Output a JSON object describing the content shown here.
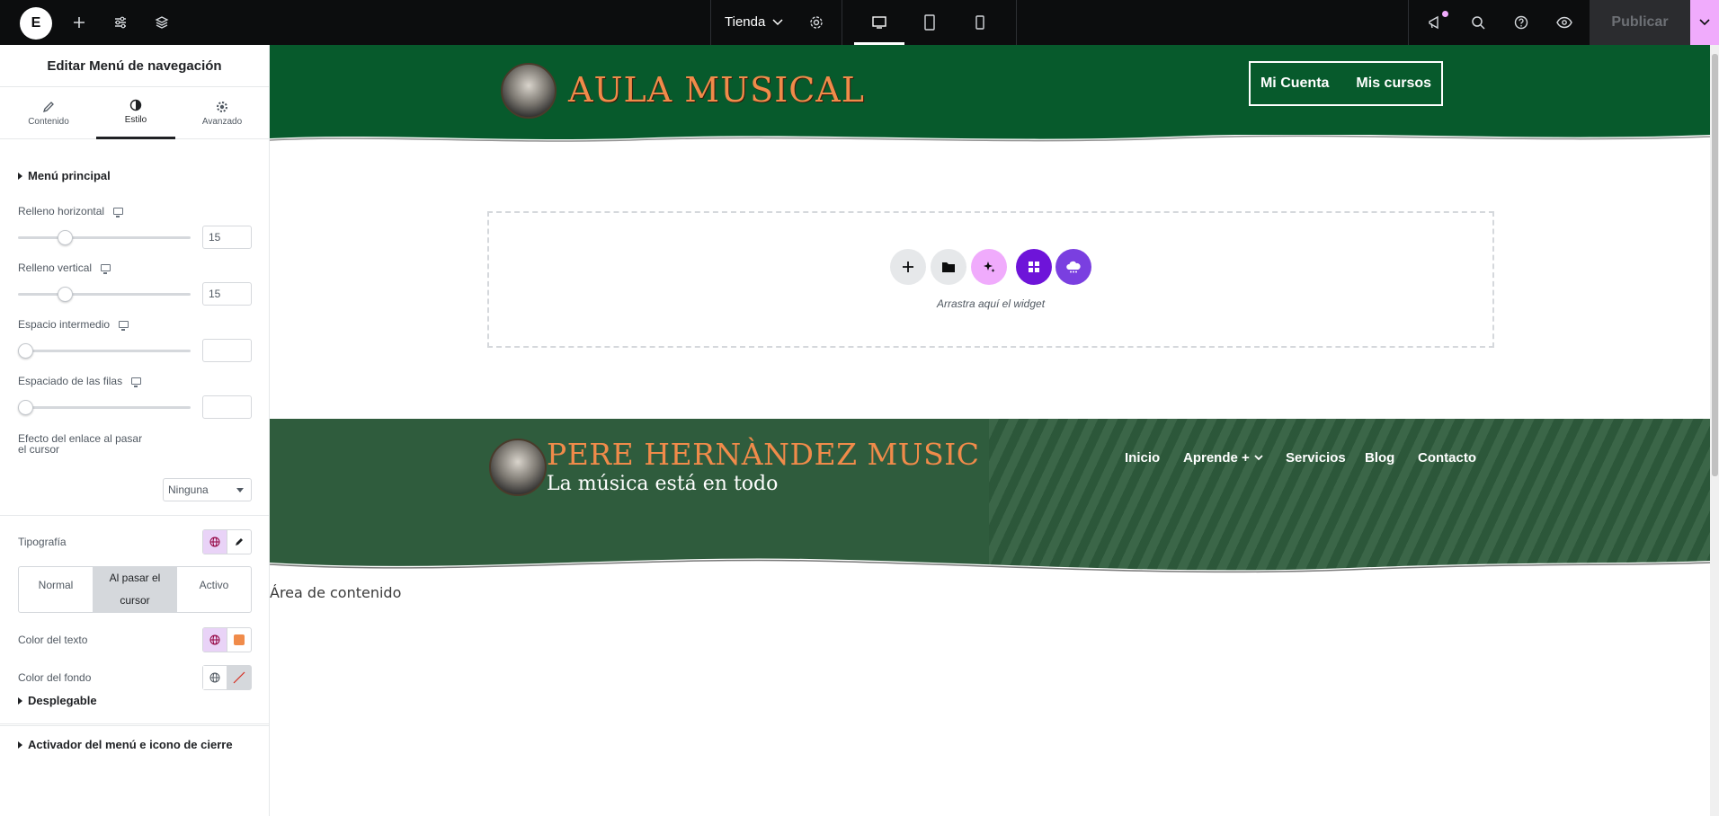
{
  "topbar": {
    "logo": "E",
    "page_selector": "Tienda",
    "publish_label": "Publicar",
    "icons": [
      "plus-icon",
      "sliders-icon",
      "layers-icon",
      "gear-icon",
      "desktop-icon",
      "tablet-icon",
      "mobile-icon",
      "megaphone-icon",
      "search-icon",
      "help-icon",
      "eye-icon",
      "chevron-down-icon"
    ]
  },
  "panel": {
    "title": "Editar Menú de navegación",
    "tabs": [
      {
        "label": "Contenido",
        "icon": "pencil-icon"
      },
      {
        "label": "Estilo",
        "icon": "half-circle-icon",
        "active": true
      },
      {
        "label": "Avanzado",
        "icon": "gear-icon"
      }
    ],
    "section_main": "Menú principal",
    "controls": {
      "padding_h": {
        "label": "Relleno horizontal",
        "value": "15",
        "level": 0.25
      },
      "padding_v": {
        "label": "Relleno vertical",
        "value": "15",
        "level": 0.25
      },
      "spacing": {
        "label": "Espacio intermedio",
        "value": "",
        "level": 0
      },
      "row_spacing": {
        "label": "Espaciado de las filas",
        "value": "",
        "level": 0
      },
      "hover_effect": {
        "label": "Efecto del enlace al pasar el cursor",
        "value": "Ninguna"
      }
    },
    "typography_label": "Tipografía",
    "states": [
      "Normal",
      "Al pasar el cursor",
      "Activo"
    ],
    "active_state": "Al pasar el cursor",
    "text_color": {
      "label": "Color del texto",
      "swatch": "#f08b4a"
    },
    "bg_color": {
      "label": "Color del fondo"
    },
    "section_dropdown": "Desplegable",
    "section_toggle": "Activador del menú e icono de cierre"
  },
  "canvas": {
    "header": {
      "brand": "AULA  MUSICAL",
      "nav": [
        "Mi Cuenta",
        "Mis cursos"
      ],
      "bg_color": "#075a2c"
    },
    "drop_zone_text": "Arrastra aquí el widget",
    "footer": {
      "title": "PERE HERNÀNDEZ MUSIC",
      "subtitle": "La música está en todo",
      "nav": [
        "Inicio",
        "Aprende +",
        "Servicios",
        "Blog",
        "Contacto"
      ]
    },
    "content_area": "Área de contenido"
  },
  "colors": {
    "accent_pink": "#f0abfc",
    "purple": "#6e14d9",
    "orange": "#f08b4a",
    "green": "#075a2c"
  }
}
